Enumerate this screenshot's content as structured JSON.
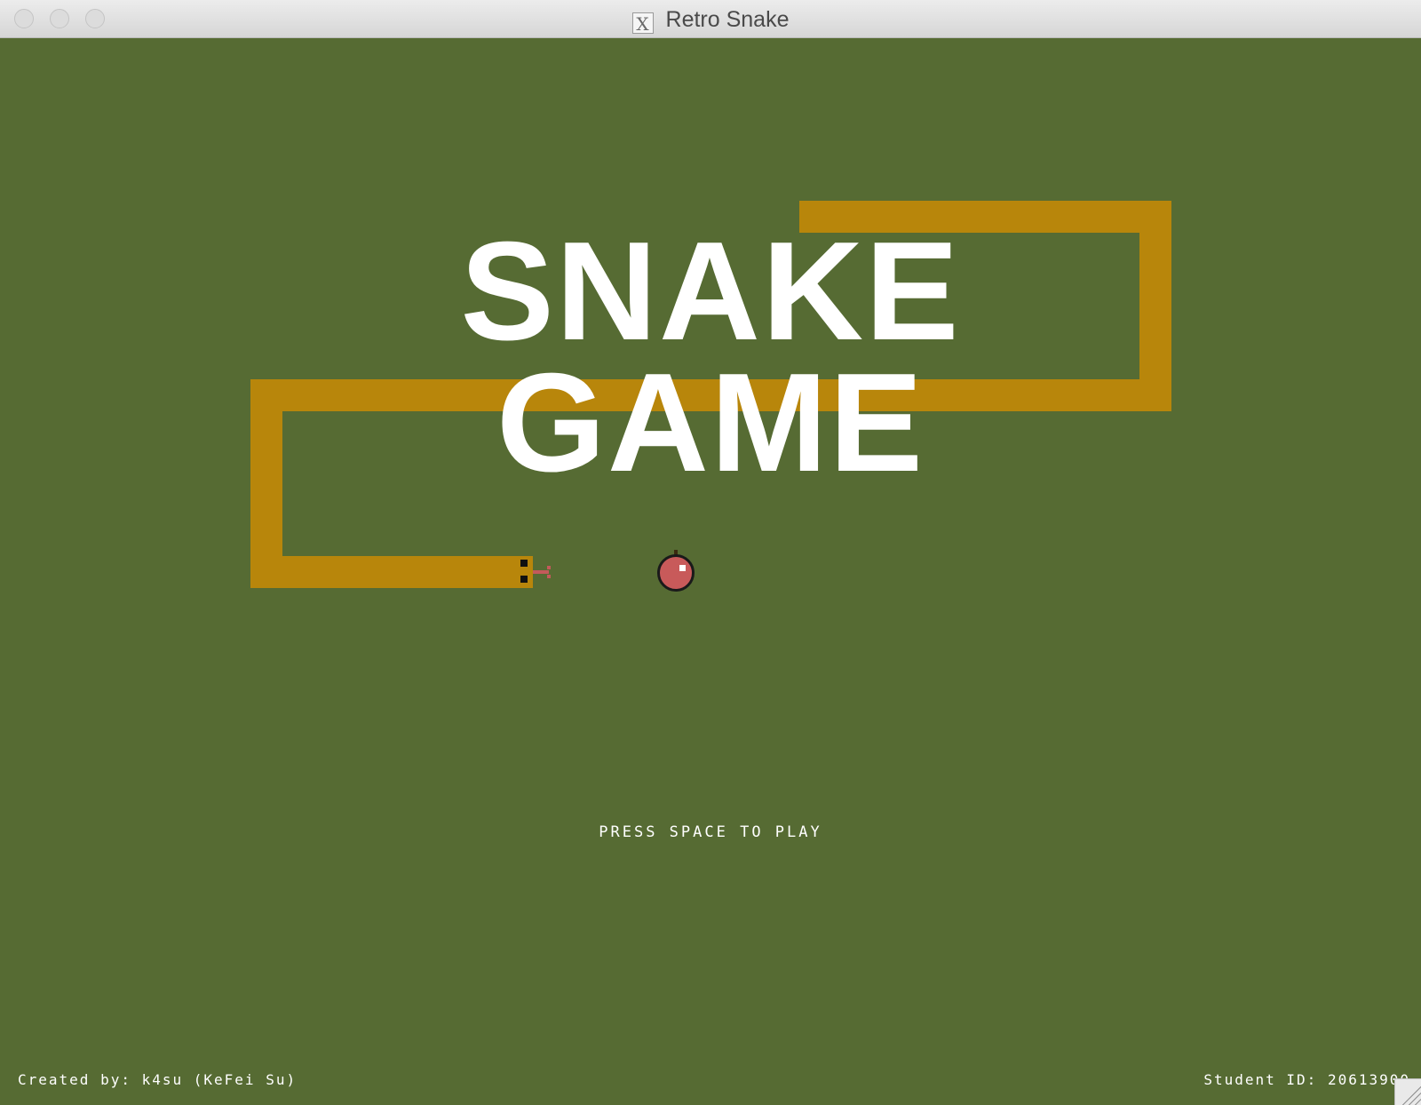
{
  "window": {
    "title": "Retro Snake",
    "icon": "x11-icon",
    "background_color": "#566b33"
  },
  "game": {
    "title_line1": "SNAKE",
    "title_line2": "GAME",
    "prompt": "PRESS SPACE TO PLAY",
    "snake_color": "#b8860b",
    "apple_color": "#c85a5a",
    "text_color": "#ffffff"
  },
  "footer": {
    "credit": "Created by: k4su (KeFei Su)",
    "student_id": "Student ID: 20613900"
  }
}
